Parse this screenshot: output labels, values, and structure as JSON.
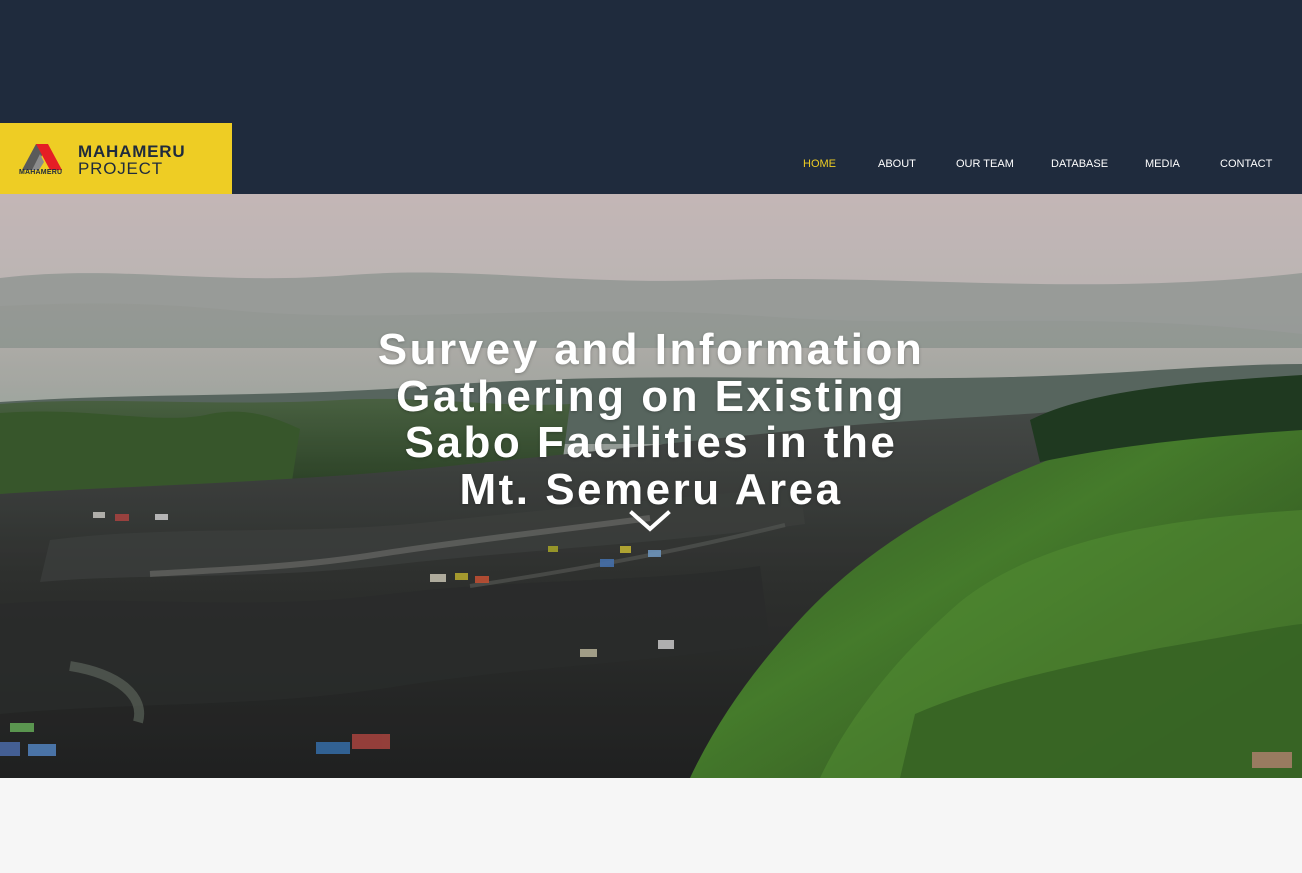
{
  "brand": {
    "logo_mark_label": "MAHAMERU",
    "title": "MAHAMERU",
    "subtitle": "PROJECT"
  },
  "nav": {
    "items": [
      {
        "label": "HOME",
        "active": true
      },
      {
        "label": "ABOUT",
        "active": false
      },
      {
        "label": "OUR TEAM",
        "active": false
      },
      {
        "label": "DATABASE",
        "active": false
      },
      {
        "label": "MEDIA",
        "active": false
      },
      {
        "label": "CONTACT",
        "active": false
      }
    ]
  },
  "hero": {
    "title_lines": [
      "Survey and Information",
      "Gathering on Existing",
      "Sabo Facilities in the",
      "Mt. Semeru Area"
    ],
    "scroll_icon": "chevron-down-icon"
  },
  "colors": {
    "header_bg": "#1f2b3d",
    "logo_bg": "#eecd24",
    "nav_active": "#eecd24",
    "nav_text": "#ffffff",
    "logo_red": "#e51e25",
    "page_bg": "#f6f6f6"
  }
}
